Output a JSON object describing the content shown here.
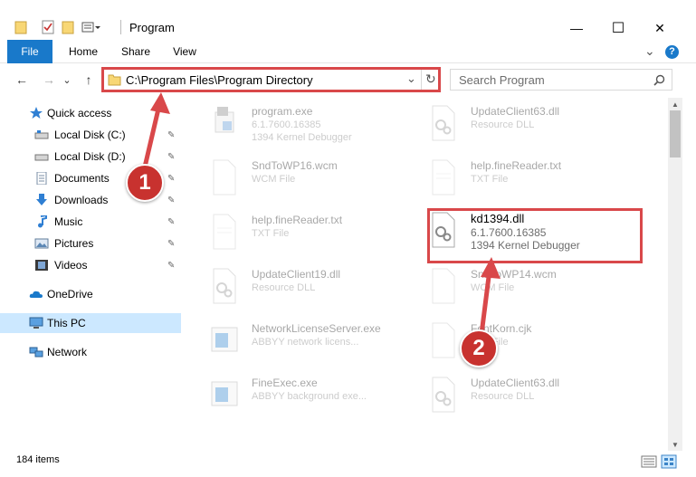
{
  "window": {
    "title": "Program",
    "minimize_glyph": "—",
    "maximize_glyph": "☐",
    "close_glyph": "✕"
  },
  "ribbon": {
    "tabs": [
      "File",
      "Home",
      "Share",
      "View"
    ],
    "expand_glyph": "⌄",
    "help_glyph": "?"
  },
  "nav_buttons": {
    "back": "←",
    "forward": "→",
    "recent": "⌄",
    "up": "↑"
  },
  "address": {
    "path": "C:\\Program Files\\Program Directory",
    "dropdown_glyph": "⌄",
    "refresh_glyph": "↻"
  },
  "search": {
    "placeholder": "Search Program",
    "icon_glyph": "⌕"
  },
  "sidebar": {
    "quick_access": "Quick access",
    "items": [
      {
        "label": "Local Disk (C:)",
        "icon": "drive-icon"
      },
      {
        "label": "Local Disk (D:)",
        "icon": "drive-icon"
      },
      {
        "label": "Documents",
        "icon": "documents-icon"
      },
      {
        "label": "Downloads",
        "icon": "downloads-icon"
      },
      {
        "label": "Music",
        "icon": "music-icon"
      },
      {
        "label": "Pictures",
        "icon": "pictures-icon"
      },
      {
        "label": "Videos",
        "icon": "videos-icon"
      }
    ],
    "pin_glyph": "✎",
    "onedrive": "OneDrive",
    "this_pc": "This PC",
    "network": "Network"
  },
  "files": [
    {
      "name": "program.exe",
      "d1": "6.1.7600.16385",
      "d2": "1394 Kernel Debugger",
      "icon": "exe-icon"
    },
    {
      "name": "UpdateClient63.dll",
      "d1": "Resource DLL",
      "d2": "",
      "icon": "dll-icon"
    },
    {
      "name": "SndToWP16.wcm",
      "d1": "WCM File",
      "d2": "",
      "icon": "generic-file-icon"
    },
    {
      "name": "help.fineReader.txt",
      "d1": "TXT File",
      "d2": "",
      "icon": "text-file-icon"
    },
    {
      "name": "help.fineReader.txt",
      "d1": "TXT File",
      "d2": "",
      "icon": "text-file-icon"
    },
    {
      "name": "kd1394.dll",
      "d1": "6.1.7600.16385",
      "d2": "1394 Kernel Debugger",
      "icon": "dll-icon"
    },
    {
      "name": "UpdateClient19.dll",
      "d1": "Resource DLL",
      "d2": "",
      "icon": "dll-icon"
    },
    {
      "name": "SndToWP14.wcm",
      "d1": "WCM File",
      "d2": "",
      "icon": "generic-file-icon"
    },
    {
      "name": "NetworkLicenseServer.exe",
      "d1": "ABBYY network licens...",
      "d2": "",
      "icon": "app-icon"
    },
    {
      "name": "FontKorn.cjk",
      "d1": "CJK File",
      "d2": "",
      "icon": "generic-file-icon"
    },
    {
      "name": "FineExec.exe",
      "d1": "ABBYY background exe...",
      "d2": "",
      "icon": "app-icon"
    },
    {
      "name": "UpdateClient63.dll",
      "d1": "Resource DLL",
      "d2": "",
      "icon": "dll-icon"
    }
  ],
  "status": {
    "count": "184 items"
  },
  "annotations": {
    "step1": "1",
    "step2": "2",
    "color": "#d9484a"
  }
}
